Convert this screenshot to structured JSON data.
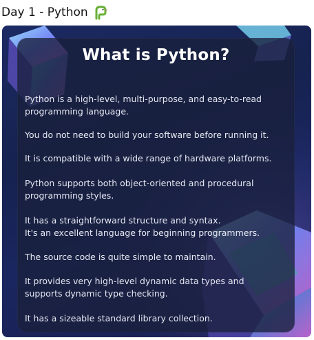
{
  "post": {
    "title": "Day 1 - Python",
    "emoji_icon": "snake-emoji-icon"
  },
  "card": {
    "heading": "What is Python?",
    "points": [
      [
        "Python is a high-level, multi-purpose, and easy-to-read",
        "programming language."
      ],
      [
        "You do not need to build your software before running it."
      ],
      [
        "It is compatible with a wide range of hardware platforms."
      ],
      [
        "Python supports both object-oriented and procedural",
        "programming styles."
      ],
      [
        "It has a straightforward structure and syntax.",
        "It's an excellent language for beginning programmers."
      ],
      [
        "The source code is quite simple to maintain."
      ],
      [
        "It provides very high-level dynamic data types and",
        "supports dynamic type checking."
      ],
      [
        "It has a sizeable standard library collection."
      ]
    ]
  },
  "colors": {
    "card_background": "#1b2a63",
    "panel_background": "#1a203c",
    "heading_text": "#ffffff",
    "body_text": "#e6e8f2",
    "emoji_green": "#7cc34a"
  }
}
